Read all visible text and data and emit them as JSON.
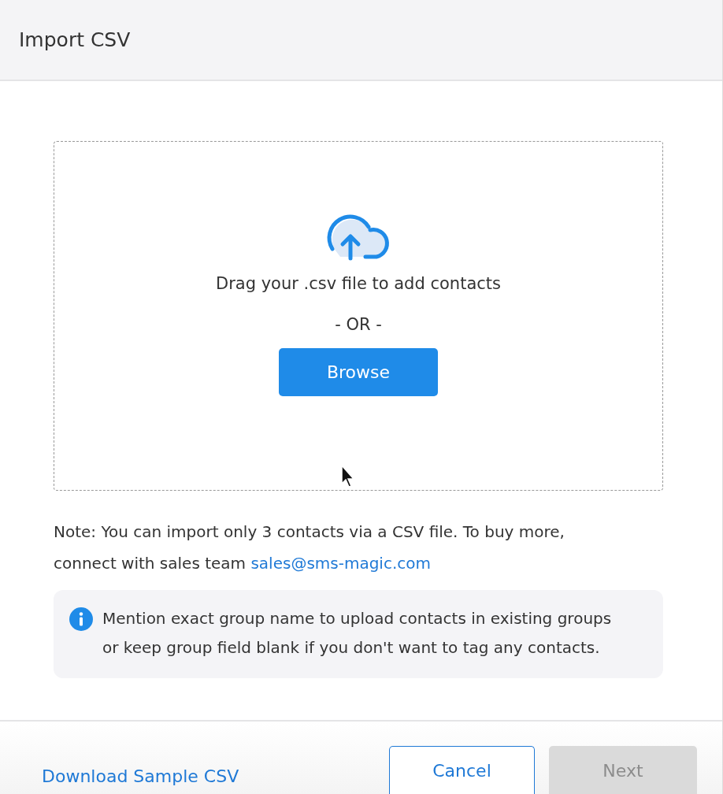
{
  "dialog": {
    "title": "Import CSV"
  },
  "dropzone": {
    "prompt": "Drag your .csv file to add contacts",
    "separator": "- OR -",
    "browse_button": "Browse"
  },
  "note": {
    "text": "Note: You can import only 3 contacts via a CSV file. To buy more, connect with sales team ",
    "link": "sales@sms-magic.com"
  },
  "info": {
    "text": "Mention exact group name to upload contacts in existing groups or keep group field blank if you don't want to tag any contacts."
  },
  "footer": {
    "link": "Download Sample CSV",
    "buttons": [
      {
        "label": "Cancel",
        "kind": "secondary",
        "disabled": false
      },
      {
        "label": "Next",
        "kind": "primary",
        "disabled": true
      }
    ]
  }
}
